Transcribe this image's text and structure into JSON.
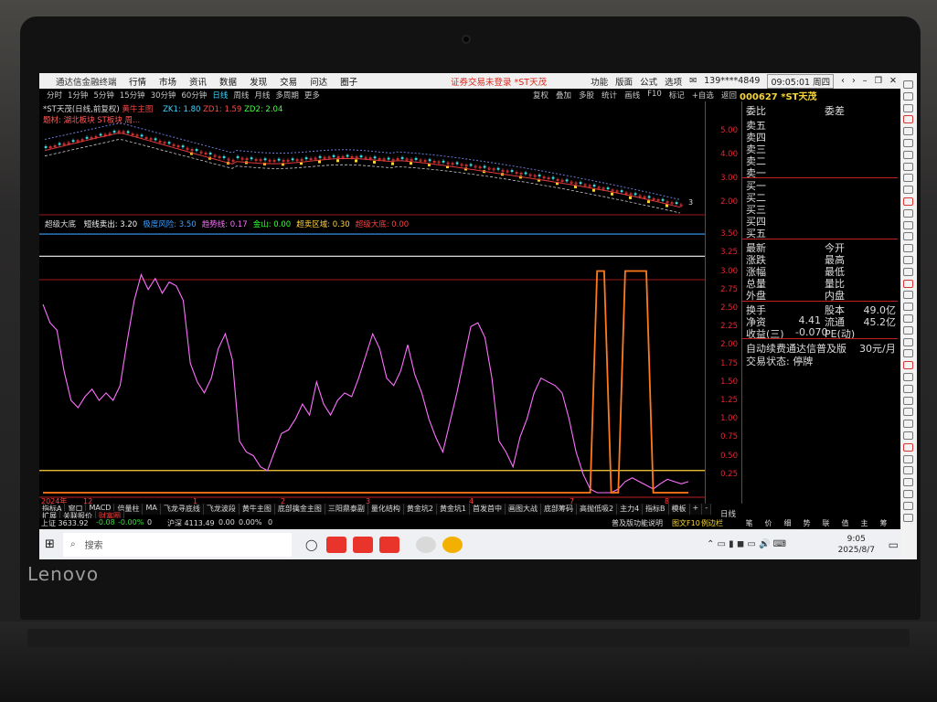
{
  "laptop": {
    "brand": "Lenovo"
  },
  "titlebar": {
    "app": "通达信金融终端",
    "menu": [
      "行情",
      "市场",
      "资讯",
      "数据",
      "发现",
      "交易",
      "问达",
      "圈子"
    ],
    "warning": "证券交易未登录  *ST天茂",
    "right": [
      "功能",
      "版面",
      "公式",
      "选项"
    ],
    "phone": "139****4849",
    "time": "09:05:01 周四"
  },
  "toolbar2": {
    "periods": [
      "分时",
      "1分钟",
      "5分钟",
      "15分钟",
      "30分钟",
      "60分钟",
      "日线",
      "周线",
      "月线",
      "多周期",
      "更多"
    ],
    "active_period": "日线",
    "tools": [
      "复权",
      "叠加",
      "多股",
      "统计",
      "画线",
      "F10",
      "标记",
      "+自选",
      "返回"
    ],
    "code": "000627 *ST天茂"
  },
  "main_chart": {
    "header": "*ST天茂(日线,前复权)",
    "indicator_name": "黄牛主图",
    "zk1": "ZK1: 1.80",
    "zd1": "ZD1: 1.59",
    "zd2": "ZD2: 2.04",
    "concept": "题材: 湖北板块 ST板块 周...",
    "yticks": [
      "5.00",
      "4.00",
      "3.00",
      "2.00"
    ],
    "last_mark": "3"
  },
  "sub_chart": {
    "name": "超级大底",
    "items": [
      {
        "label": "短线卖出: 3.20",
        "color": "#f5f5f5"
      },
      {
        "label": "极度风险: 3.50",
        "color": "#3ea0ff"
      },
      {
        "label": "趋势线: 0.17",
        "color": "#ff70ff"
      },
      {
        "label": "金山: 0.00",
        "color": "#33ff33"
      },
      {
        "label": "超卖区域: 0.30",
        "color": "#ffd23a"
      },
      {
        "label": "超级大底: 0.00",
        "color": "#ff4040"
      }
    ],
    "yticks": [
      "3.50",
      "3.25",
      "3.00",
      "2.75",
      "2.50",
      "2.25",
      "2.00",
      "1.75",
      "1.50",
      "1.25",
      "1.00",
      "0.75",
      "0.50",
      "0.25"
    ]
  },
  "chart_data": {
    "type": "line",
    "title": "超级大底",
    "ylim": [
      0,
      3.6
    ],
    "lines_constant": [
      {
        "name": "极度风险",
        "value": 3.5,
        "color": "#3ea0ff"
      },
      {
        "name": "短线卖出",
        "value": 3.2,
        "color": "#f5f5f5"
      },
      {
        "name": "超卖区域",
        "value": 0.3,
        "color": "#ffd23a"
      }
    ],
    "series": [
      {
        "name": "趋势线",
        "color": "#ff70ff",
        "values": [
          2.55,
          2.3,
          2.2,
          1.65,
          1.25,
          1.15,
          1.3,
          1.4,
          1.25,
          1.35,
          1.25,
          1.45,
          2.05,
          2.6,
          2.95,
          2.75,
          2.9,
          2.7,
          2.85,
          2.8,
          2.6,
          1.75,
          1.5,
          1.35,
          1.55,
          1.95,
          2.15,
          1.8,
          0.7,
          0.55,
          0.5,
          0.35,
          0.3,
          0.55,
          0.8,
          0.85,
          1.0,
          1.2,
          1.05,
          1.5,
          1.2,
          1.05,
          1.25,
          1.35,
          1.3,
          1.55,
          1.85,
          2.15,
          1.95,
          1.55,
          1.45,
          1.65,
          2.0,
          1.6,
          1.35,
          1.0,
          0.75,
          0.55,
          0.95,
          1.35,
          1.8,
          2.25,
          2.3,
          2.1,
          1.55,
          0.7,
          0.55,
          0.35,
          0.75,
          1.0,
          1.35,
          1.55,
          1.5,
          1.45,
          1.35,
          1.0,
          0.55,
          0.25,
          0.05,
          0.0,
          0.0,
          0.0,
          0.05,
          0.15,
          0.2,
          0.15,
          0.1,
          0.05,
          0.12,
          0.18,
          0.15,
          0.12,
          0.15
        ]
      },
      {
        "name": "金山",
        "color": "#ff7a1a",
        "values": [
          0,
          0,
          0,
          0,
          0,
          0,
          0,
          0,
          0,
          0,
          0,
          0,
          0,
          0,
          0,
          0,
          0,
          0,
          0,
          0,
          0,
          0,
          0,
          0,
          0,
          0,
          0,
          0,
          0,
          0,
          0,
          0,
          0,
          0,
          0,
          0,
          0,
          0,
          0,
          0,
          0,
          0,
          0,
          0,
          0,
          0,
          0,
          0,
          0,
          0,
          0,
          0,
          0,
          0,
          0,
          0,
          0,
          0,
          0,
          0,
          0,
          0,
          0,
          0,
          0,
          0,
          0,
          0,
          0,
          0,
          0,
          0,
          0,
          0,
          0,
          0,
          0,
          0,
          0,
          3.0,
          3.0,
          0,
          0,
          3.0,
          3.0,
          3.0,
          3.0,
          0,
          0,
          0,
          0,
          0,
          0
        ]
      }
    ],
    "x_markers": [
      "1",
      "2",
      "3",
      "4",
      "7",
      "8"
    ],
    "x_start_label": "2024年",
    "x_start_marker": "12"
  },
  "side": {
    "header_left": "委比",
    "header_right": "委差",
    "asks": [
      "卖五",
      "卖四",
      "卖三",
      "卖二",
      "卖一"
    ],
    "bids": [
      "买一",
      "买二",
      "买三",
      "买四",
      "买五"
    ],
    "stats": [
      {
        "l": "最新",
        "r": "今开"
      },
      {
        "l": "涨跌",
        "r": "最高"
      },
      {
        "l": "涨幅",
        "r": "最低"
      },
      {
        "l": "总量",
        "r": "量比"
      },
      {
        "l": "外盘",
        "r": "内盘"
      }
    ],
    "stats2": [
      {
        "l": "换手",
        "r": "股本",
        "v": "49.0亿"
      },
      {
        "l": "净资",
        "lv": "4.41",
        "r": "流通",
        "v": "45.2亿"
      },
      {
        "l": "收益(三)",
        "lv": "-0.070",
        "r": "PE(动)"
      }
    ],
    "promo": "自动续费通达信普及版",
    "promo_price": "30元/月",
    "trade_state": "交易状态: 停牌"
  },
  "tabs": {
    "row1": [
      "指标A",
      "窗口",
      "MACD",
      "倍量柱",
      "MA",
      "飞龙寻底线",
      "飞龙波段",
      "黄牛主图",
      "底部擒金主图",
      "三阳鼎泰副",
      "量化结构",
      "黄金坑2",
      "黄金坑1",
      "首发首中",
      "画图大战",
      "底部筹码",
      "高抛低吸2",
      "主力4"
    ],
    "row1_right": [
      "指标B",
      "模板",
      "+",
      "-"
    ],
    "row2": [
      "扩展",
      "关联报价",
      "财富圈"
    ],
    "period_label": "日线"
  },
  "statusbar": {
    "sh": "上证 3633.92",
    "sh_chg": "-0.08",
    "sh_pct": "-0.00%",
    "sh_amt": "0",
    "sz": "沪深 4113.49",
    "sz_chg": "0.00",
    "sz_pct": "0.00%",
    "sz_amt": "0",
    "right": "普及版功能说明",
    "right2": "图文F10",
    "right3": "例边栏",
    "bottom_tabs": [
      "笔",
      "价",
      "细",
      "势",
      "联",
      "值",
      "主",
      "筹"
    ]
  },
  "taskbar": {
    "search": "搜索",
    "time": "9:05",
    "date": "2025/8/7"
  }
}
